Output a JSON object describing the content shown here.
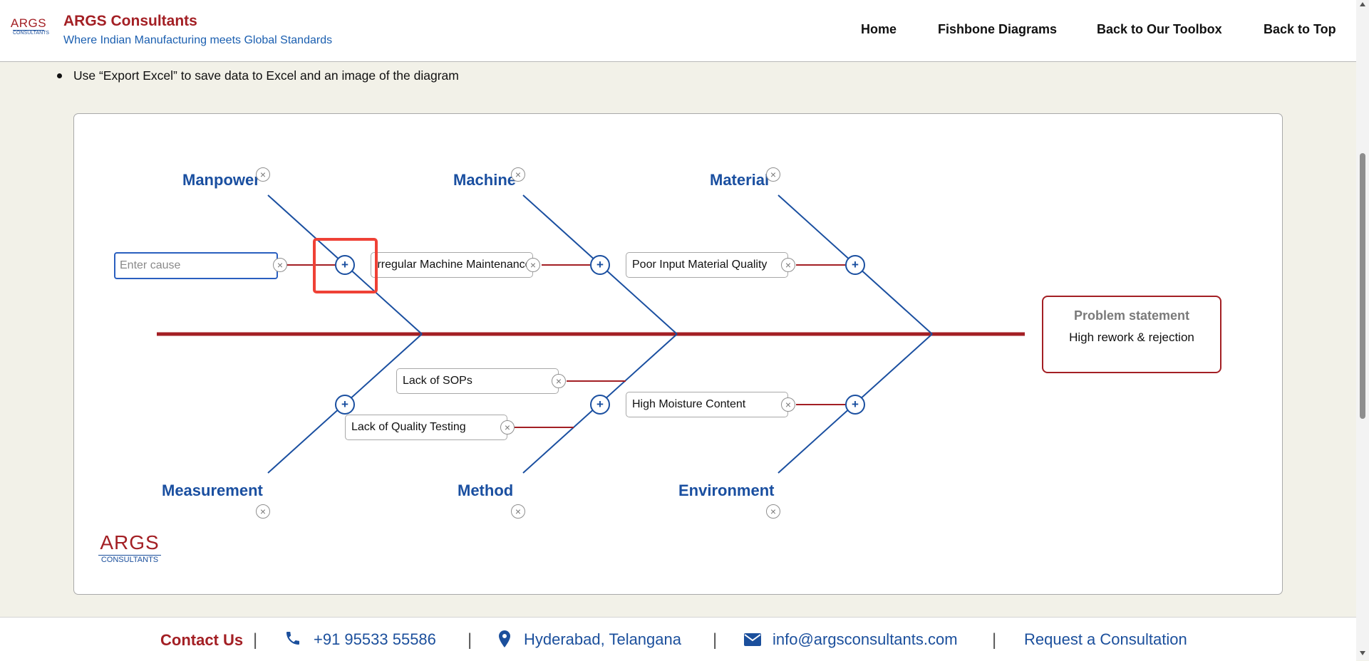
{
  "header": {
    "logo_line1": "ARGS",
    "logo_line2": "CONSULTANTS",
    "title": "ARGS Consultants",
    "subtitle": "Where Indian Manufacturing meets Global Standards",
    "nav": [
      "Home",
      "Fishbone Diagrams",
      "Back to Our Toolbox",
      "Back to Top"
    ]
  },
  "instruction": "Use “Export Excel” to save data to Excel and an image of the diagram",
  "diagram": {
    "categories": {
      "manpower": "Manpower",
      "machine": "Machine",
      "material": "Material",
      "measurement": "Measurement",
      "method": "Method",
      "environment": "Environment"
    },
    "causes": {
      "machine": "Irregular Machine Maintenance",
      "material": "Poor Input Material Quality",
      "method_1": "Lack of SOPs",
      "measurement_1": "Lack of Quality Testing",
      "environment_1": "High Moisture Content"
    },
    "new_cause_placeholder": "Enter cause",
    "close_glyph": "×",
    "add_glyph": "+",
    "problem_heading": "Problem statement",
    "problem_text": "High rework & rejection",
    "colors": {
      "spine": "#a31f24",
      "bone": "#1a4fa0",
      "highlight": "#ef4136"
    }
  },
  "footer": {
    "contact_label": "Contact Us",
    "separator": "|",
    "phone": "+91 95533 55586",
    "location": "Hyderabad, Telangana",
    "email": "info@argsconsultants.com",
    "consult_link": "Request a Consultation"
  }
}
